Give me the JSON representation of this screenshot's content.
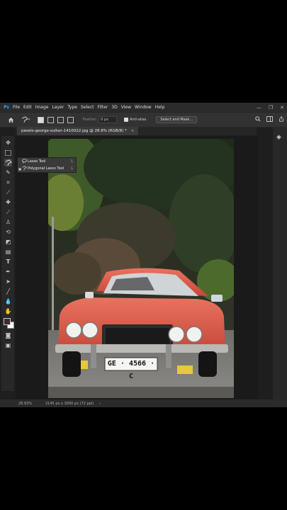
{
  "app": {
    "logo": "Ps"
  },
  "menu": [
    "File",
    "Edit",
    "Image",
    "Layer",
    "Type",
    "Select",
    "Filter",
    "3D",
    "View",
    "Window",
    "Help"
  ],
  "window_controls": {
    "minimize": "—",
    "maximize": "❐",
    "close": "✕"
  },
  "options": {
    "home_icon": "home-icon",
    "tool_icon": "polygonal-lasso-icon",
    "feather_label": "Feather:",
    "feather_value": "0 px",
    "anti_alias_label": "Anti-alias",
    "anti_alias_checked": true,
    "select_mask_label": "Select and Mask..."
  },
  "document": {
    "tab_title": "pexels-george-sultan-1410022.jpg @ 28.8% (RGB/8) *",
    "close_glyph": "×"
  },
  "tool_flyout": [
    {
      "label": "Lasso Tool",
      "shortcut": "L",
      "active": false
    },
    {
      "label": "Polygonal Lasso Tool",
      "shortcut": "L",
      "active": true
    }
  ],
  "photo": {
    "plate_text": "GE · 4566 · C",
    "car_color": "#e05a48",
    "sky_color": "#1e2a1c"
  },
  "status": {
    "zoom": "28.83%",
    "doc_info": "2145 px x 3000 px (72 ppi)",
    "arrow": "›"
  },
  "colors": {
    "foreground": "#3a2a30",
    "background": "#ffffff",
    "accent": "#31a8ff"
  }
}
